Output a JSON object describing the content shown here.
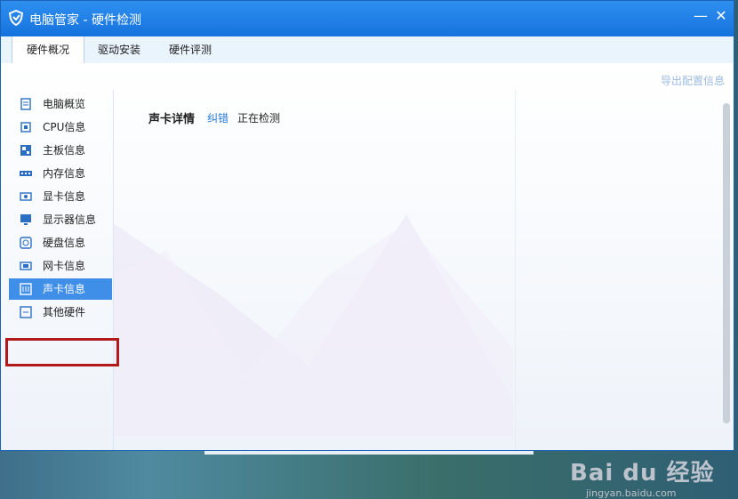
{
  "window": {
    "title": "电脑管家 - 硬件检测"
  },
  "tabs": [
    {
      "label": "硬件概况",
      "active": true
    },
    {
      "label": "驱动安装",
      "active": false
    },
    {
      "label": "硬件评测",
      "active": false
    }
  ],
  "toolbar": {
    "export_label": "导出配置信息"
  },
  "sidebar": {
    "items": [
      {
        "label": "电脑概览",
        "icon": "clipboard-icon"
      },
      {
        "label": "CPU信息",
        "icon": "cpu-icon"
      },
      {
        "label": "主板信息",
        "icon": "motherboard-icon"
      },
      {
        "label": "内存信息",
        "icon": "memory-icon"
      },
      {
        "label": "显卡信息",
        "icon": "graphics-card-icon"
      },
      {
        "label": "显示器信息",
        "icon": "monitor-icon"
      },
      {
        "label": "硬盘信息",
        "icon": "disk-icon"
      },
      {
        "label": "网卡信息",
        "icon": "network-card-icon"
      },
      {
        "label": "声卡信息",
        "icon": "sound-card-icon",
        "selected": true
      },
      {
        "label": "其他硬件",
        "icon": "other-hardware-icon"
      }
    ]
  },
  "main": {
    "section_title": "声卡详情",
    "report_link": "纠错",
    "status": "正在检测"
  },
  "watermark": {
    "brand": "Bai du 经验",
    "url": "jingyan.baidu.com"
  },
  "colors": {
    "titlebar": "#1a7ae6",
    "selected_item": "#3f8ee8",
    "highlight_box": "#b01a1a",
    "link": "#2a7ad6"
  }
}
